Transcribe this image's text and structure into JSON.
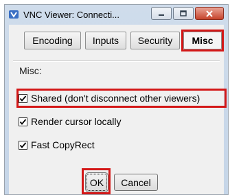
{
  "window": {
    "title": "VNC Viewer: Connecti..."
  },
  "tabs": [
    {
      "label": "Encoding",
      "active": false
    },
    {
      "label": "Inputs",
      "active": false
    },
    {
      "label": "Security",
      "active": false
    },
    {
      "label": "Misc",
      "active": true
    }
  ],
  "misc": {
    "section_label": "Misc:",
    "options": [
      {
        "label": "Shared (don't disconnect other viewers)",
        "checked": true
      },
      {
        "label": "Render cursor locally",
        "checked": true
      },
      {
        "label": "Fast CopyRect",
        "checked": true
      }
    ]
  },
  "buttons": {
    "ok": "OK",
    "cancel": "Cancel"
  },
  "colors": {
    "highlight": "#d31717",
    "close_button": "#c6432b"
  },
  "icons": {
    "app": "vnc-app-icon",
    "minimize": "minimize-icon",
    "maximize": "maximize-icon",
    "close": "close-icon",
    "check": "checkmark-icon"
  }
}
